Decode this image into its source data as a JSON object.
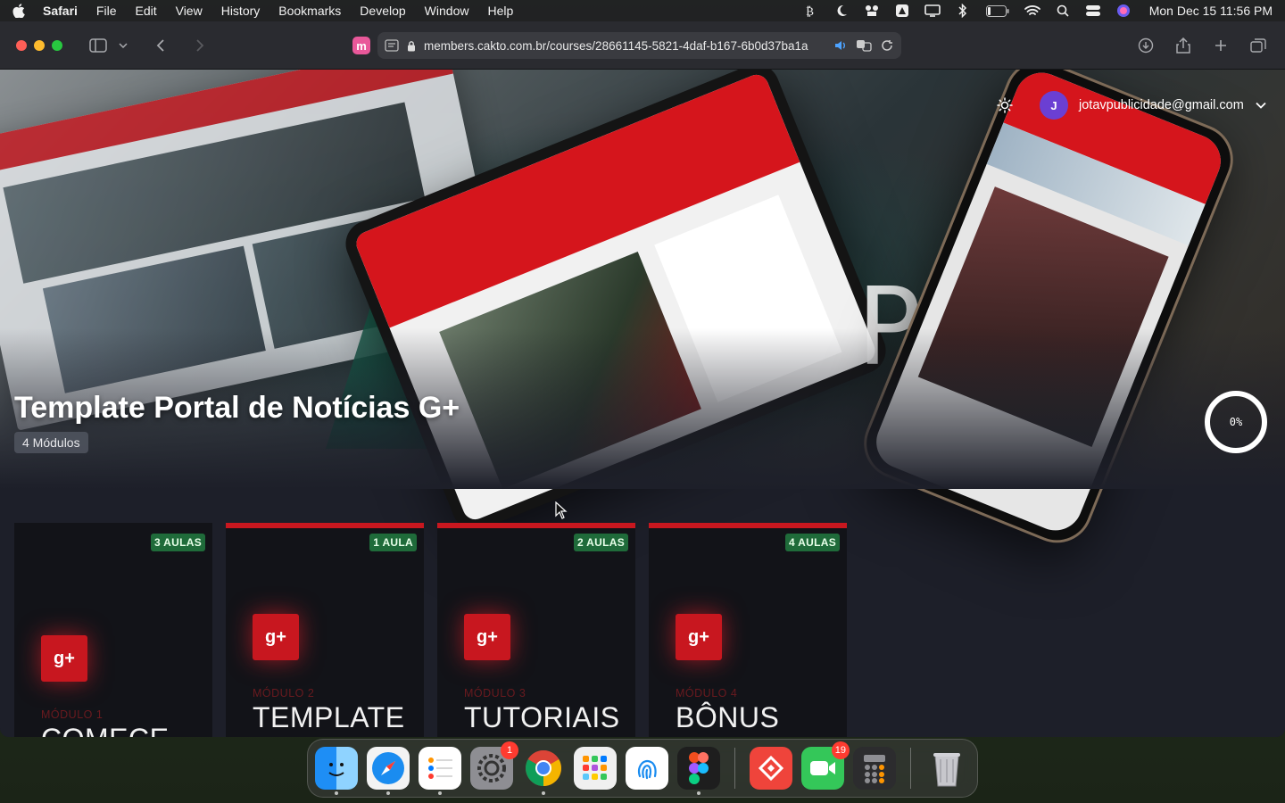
{
  "menubar": {
    "app_name": "Safari",
    "items": [
      "File",
      "Edit",
      "View",
      "History",
      "Bookmarks",
      "Develop",
      "Window",
      "Help"
    ],
    "clock": "Mon Dec 15  11:56 PM"
  },
  "browser": {
    "url": "members.cakto.com.br/courses/28661145-5821-4daf-b167-6b0d37ba1a",
    "site_icon_letter": "m"
  },
  "header": {
    "avatar_letter": "J",
    "user_email": "jotavpublicidade@gmail.com"
  },
  "hero": {
    "title": "Template Portal de Notícias G+",
    "modules_count": "4 Módulos",
    "progress_percent": 0,
    "progress_label": "0%",
    "decor_letter": "P"
  },
  "modules": [
    {
      "lessons": "3 AULAS",
      "icon_text": "g+",
      "label": "MÓDULO 1",
      "name": "COMECE"
    },
    {
      "lessons": "1 AULA",
      "icon_text": "g+",
      "label": "MÓDULO 2",
      "name": "TEMPLATE"
    },
    {
      "lessons": "2 AULAS",
      "icon_text": "g+",
      "label": "MÓDULO 3",
      "name": "TUTORIAIS"
    },
    {
      "lessons": "4 AULAS",
      "icon_text": "g+",
      "label": "MÓDULO 4",
      "name": "BÔNUS"
    }
  ],
  "dock": {
    "settings_badge": "1",
    "facetime_badge": "19"
  },
  "colors": {
    "accent_red": "#c8171f",
    "lesson_badge_green": "#1f6b3a",
    "avatar_purple": "#6b3fd3"
  }
}
